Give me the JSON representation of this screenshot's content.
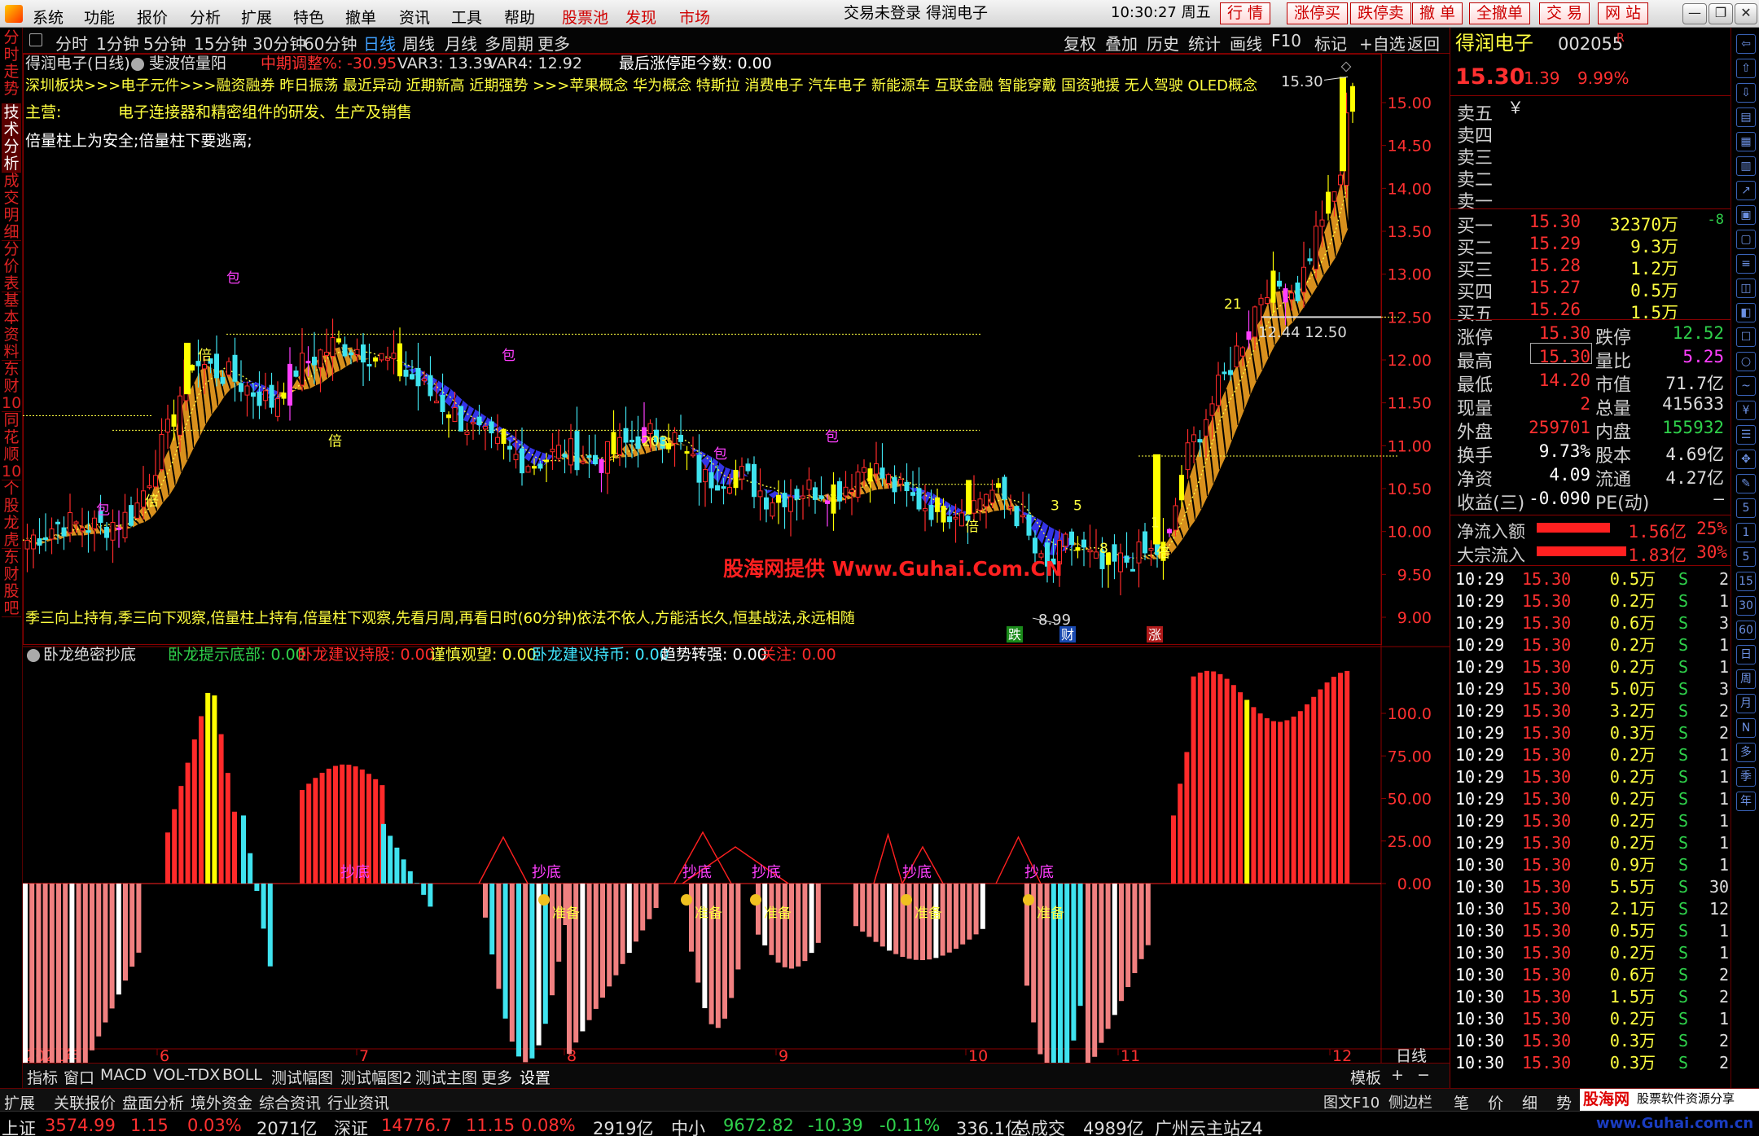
{
  "titlebar": {
    "menus": [
      "系统",
      "功能",
      "报价",
      "分析",
      "扩展",
      "特色",
      "撤单",
      "资讯",
      "工具",
      "帮助"
    ],
    "hot": [
      "股票池",
      "发现",
      "市场"
    ],
    "center": "交易未登录  得润电子",
    "clock": "10:30:27 周五",
    "rbuttons": [
      "行 情",
      "涨停买",
      "跌停卖",
      "撤 单",
      "全撤单",
      "交 易",
      "网 站"
    ]
  },
  "lefttabs": [
    "分时走势",
    "技术分析",
    "成交明细",
    "分价表",
    "基本资料",
    "东财10",
    "同花顺10",
    "个股龙虎",
    "东财股吧"
  ],
  "ktools": {
    "periods": [
      "分时",
      "1分钟",
      "5分钟",
      "15分钟",
      "30分钟",
      "60分钟",
      "日线",
      "周线",
      "月线",
      "多周期",
      "更多"
    ],
    "right": [
      "复权",
      "叠加",
      "历史",
      "统计",
      "画线",
      "F10",
      "标记",
      "+自选",
      "返回"
    ]
  },
  "main": {
    "name": "得润电子(日线)",
    "indicator": "斐波倍量阳",
    "mid_label": "中期调整%:",
    "mid_val": "-30.95",
    "var3": "VAR3: 13.39",
    "var4": "VAR4: 12.92",
    "last_limit": "最后涨停距今数: 0.00",
    "concepts": "深圳板块>>>电子元件>>>融资融券 昨日振荡 最近异动 近期新高 近期强势 >>>苹果概念 华为概念 特斯拉 消费电子 汽车电子 新能源车 互联金融 智能穿戴 国资驰援 无人驾驶 OLED概念",
    "biz_label": "主营:",
    "biz": "电子连接器和精密组件的研发、生产及销售",
    "tip": "倍量柱上为安全;倍量柱下要逃离;",
    "motto": "季三向上持有,季三向下观察,倍量柱上持有,倍量柱下观察,先看月周,再看日时(60分钟)依法不依人,方能活长久,恒基战法,永远相随",
    "watermark": "股海网提供 Www.Guhai.Com.CN",
    "hi_label": "15.30",
    "lo_label": "8.99",
    "mid_labels": "12.44  12.50",
    "yticks": [
      "15.00",
      "14.50",
      "14.00",
      "13.50",
      "13.00",
      "12.50",
      "12.00",
      "11.50",
      "11.00",
      "10.50",
      "10.00",
      "9.50",
      "9.00"
    ]
  },
  "sub": {
    "name": "卧龙绝密抄底",
    "fields": [
      {
        "t": "卧龙提示底部: 0.00",
        "c": "#2fd14b"
      },
      {
        "t": "卧龙建议持股: 0.00",
        "c": "#ff2a2a"
      },
      {
        "t": "谨慎观望: 0.00",
        "c": "#ffff40"
      },
      {
        "t": "卧龙建议持币: 0.00",
        "c": "#40e6ff"
      },
      {
        "t": "趋势转强: 0.00",
        "c": "#ffffff"
      },
      {
        "t": "关注: 0.00",
        "c": "#ff2a2a"
      }
    ],
    "yticks": [
      "100.0",
      "75.00",
      "50.00",
      "25.00",
      "0.00"
    ],
    "buy_label": "抄底",
    "ready_label": "准备"
  },
  "xaxis": {
    "labels": [
      "2021年",
      "6",
      "7",
      "8",
      "9",
      "10",
      "11",
      "12"
    ],
    "right": "日线"
  },
  "btabs": [
    "指标",
    "窗口",
    "MACD",
    "VOL-TDX",
    "BOLL",
    "测试幅图",
    "测试幅图2",
    "测试主图",
    "更多",
    "设置"
  ],
  "btabs_right": [
    "模板",
    "+",
    "−"
  ],
  "lbtabs": [
    "扩展",
    "关联报价",
    "盘面分析",
    "境外资金",
    "综合资讯",
    "行业资讯"
  ],
  "lbtabs_right": [
    "图文F10",
    "侧边栏"
  ],
  "rp": {
    "name": "得润电子",
    "code": "002055",
    "price": "15.30",
    "chg": "1.39",
    "pct": "9.99%",
    "asks": [
      "卖五",
      "卖四",
      "卖三",
      "卖二",
      "卖一"
    ],
    "bids": [
      [
        "买一",
        "15.30",
        "32370万",
        "-8"
      ],
      [
        "买二",
        "15.29",
        "9.3万",
        ""
      ],
      [
        "买三",
        "15.28",
        "1.2万",
        ""
      ],
      [
        "买四",
        "15.27",
        "0.5万",
        ""
      ],
      [
        "买五",
        "15.26",
        "1.5万",
        ""
      ]
    ],
    "stats": [
      [
        "涨停",
        "15.30",
        "跌停",
        "12.52"
      ],
      [
        "最高",
        "15.30",
        "量比",
        "5.25"
      ],
      [
        "最低",
        "14.20",
        "市值",
        "71.7亿"
      ],
      [
        "现量",
        "2",
        "总量",
        "415633"
      ],
      [
        "外盘",
        "259701",
        "内盘",
        "155932"
      ],
      [
        "换手",
        "9.73%",
        "股本",
        "4.69亿"
      ],
      [
        "净资",
        "4.09",
        "流通",
        "4.27亿"
      ],
      [
        "收益(三)",
        "-0.090",
        "PE(动)",
        "—"
      ]
    ],
    "flows": [
      [
        "净流入额",
        "1.56亿",
        "25%"
      ],
      [
        "大宗流入",
        "1.83亿",
        "30%"
      ]
    ],
    "trades": [
      [
        "10:29",
        "15.30",
        "0.5万",
        "S",
        "2"
      ],
      [
        "10:29",
        "15.30",
        "0.2万",
        "S",
        "1"
      ],
      [
        "10:29",
        "15.30",
        "0.6万",
        "S",
        "3"
      ],
      [
        "10:29",
        "15.30",
        "0.2万",
        "S",
        "1"
      ],
      [
        "10:29",
        "15.30",
        "0.2万",
        "S",
        "1"
      ],
      [
        "10:29",
        "15.30",
        "5.0万",
        "S",
        "3"
      ],
      [
        "10:29",
        "15.30",
        "3.2万",
        "S",
        "2"
      ],
      [
        "10:29",
        "15.30",
        "0.3万",
        "S",
        "2"
      ],
      [
        "10:29",
        "15.30",
        "0.2万",
        "S",
        "1"
      ],
      [
        "10:29",
        "15.30",
        "0.2万",
        "S",
        "1"
      ],
      [
        "10:29",
        "15.30",
        "0.2万",
        "S",
        "1"
      ],
      [
        "10:29",
        "15.30",
        "0.2万",
        "S",
        "1"
      ],
      [
        "10:29",
        "15.30",
        "0.2万",
        "S",
        "1"
      ],
      [
        "10:30",
        "15.30",
        "0.9万",
        "S",
        "1"
      ],
      [
        "10:30",
        "15.30",
        "5.5万",
        "S",
        "30"
      ],
      [
        "10:30",
        "15.30",
        "2.1万",
        "S",
        "12"
      ],
      [
        "10:30",
        "15.30",
        "0.5万",
        "S",
        "1"
      ],
      [
        "10:30",
        "15.30",
        "0.2万",
        "S",
        "1"
      ],
      [
        "10:30",
        "15.30",
        "0.6万",
        "S",
        "2"
      ],
      [
        "10:30",
        "15.30",
        "1.5万",
        "S",
        "2"
      ],
      [
        "10:30",
        "15.30",
        "0.2万",
        "S",
        "1"
      ],
      [
        "10:30",
        "15.30",
        "0.3万",
        "S",
        "2"
      ],
      [
        "10:30",
        "15.30",
        "0.3万",
        "S",
        "2"
      ]
    ],
    "bottom": [
      "笔",
      "价",
      "细",
      "势"
    ]
  },
  "status": [
    {
      "t": "上证",
      "c": "#ddd"
    },
    {
      "t": "3574.99",
      "c": "#ff3030"
    },
    {
      "t": "1.15",
      "c": "#ff3030"
    },
    {
      "t": "0.03%",
      "c": "#ff3030"
    },
    {
      "t": "2071亿",
      "c": "#ddd"
    },
    {
      "t": "深证",
      "c": "#ddd"
    },
    {
      "t": "14776.7",
      "c": "#ff3030"
    },
    {
      "t": "11.15",
      "c": "#ff3030"
    },
    {
      "t": "0.08%",
      "c": "#ff3030"
    },
    {
      "t": "2919亿",
      "c": "#ddd"
    },
    {
      "t": "中小",
      "c": "#ddd"
    },
    {
      "t": "9672.82",
      "c": "#2fd14b"
    },
    {
      "t": "-10.39",
      "c": "#2fd14b"
    },
    {
      "t": "-0.11%",
      "c": "#2fd14b"
    },
    {
      "t": "336.1亿",
      "c": "#ddd"
    },
    {
      "t": "总成交",
      "c": "#ddd"
    },
    {
      "t": "4989亿",
      "c": "#ddd"
    },
    {
      "t": "广州云主站Z4",
      "c": "#ddd"
    }
  ],
  "brand": {
    "logo": "股海网",
    "sub": "股票软件资源分享",
    "url": "www.Guhai.com.cn"
  },
  "colors": {
    "up": "#ff2a2a",
    "down": "#3fe3ef",
    "yellow": "#ffff00",
    "magenta": "#ff3fff",
    "blue": "#3a3aff",
    "orange": "#f0a020",
    "grid": "#8a0000"
  },
  "chart_data": {
    "type": "candlestick",
    "x_start": "2021年",
    "x_end": "12",
    "price_range": [
      8.8,
      15.6
    ],
    "month_labels": [
      "2021年",
      "6",
      "7",
      "8",
      "9",
      "10",
      "11",
      "12"
    ],
    "last_close": 15.3,
    "high": 15.3,
    "low_marked": 8.99,
    "osc_range": [
      -175,
      125
    ]
  }
}
